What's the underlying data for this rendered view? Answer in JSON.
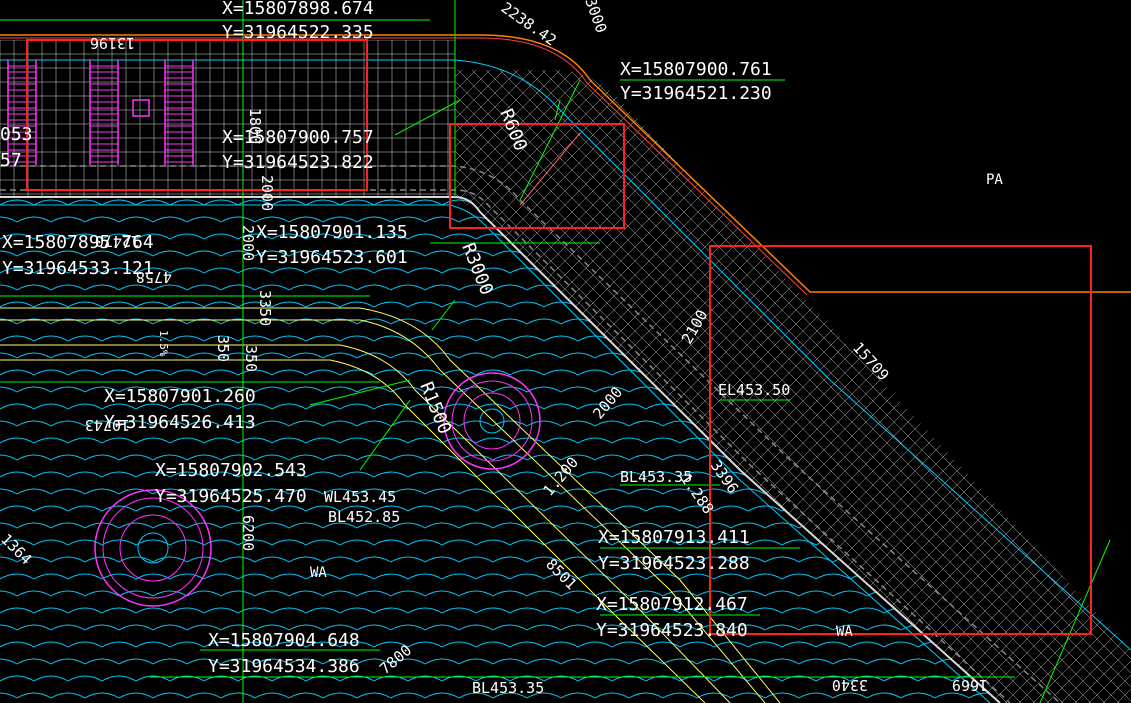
{
  "colors": {
    "background": "#000000",
    "coordinate_text": "#ffffff",
    "leader": "#00ff00",
    "water_line": "#00ccff",
    "boundary": "#ff7f00",
    "highlight_box": "#ff2020",
    "grid": "#d8d8d8",
    "contour_yellow": "#ffff66",
    "magenta": "#ff33ff",
    "cyan": "#00ffff"
  },
  "zone_labels": [
    "PA",
    "WA",
    "WA"
  ],
  "coordinates": [
    {
      "x": "X=15807898.674",
      "y": "Y=31964522.335"
    },
    {
      "x": "X=15807900.761",
      "y": "Y=31964521.230"
    },
    {
      "x": "X=15807900.757",
      "y": "Y=31964523.822"
    },
    {
      "x": "X=15807901.135",
      "y": "Y=31964523.601"
    },
    {
      "x": "X=15807895.764",
      "y": "Y=31964533.121"
    },
    {
      "x": "X=15807901.260",
      "y": "Y=31964526.413"
    },
    {
      "x": "X=15807902.543",
      "y": "Y=31964525.470"
    },
    {
      "x": "X=15807913.411",
      "y": "Y=31964523.288"
    },
    {
      "x": "X=15807912.467",
      "y": "Y=31964523.840"
    },
    {
      "x": "X=15807904.648",
      "y": "Y=31964534.386"
    }
  ],
  "level_labels": [
    "WL453.45",
    "BL452.85",
    "EL453.50",
    "BL453.35",
    "BL453.35"
  ],
  "radius_labels": [
    "R600",
    "R3000",
    "R1500"
  ],
  "dimension_labels": [
    "13196",
    "3000",
    "2238.42",
    "1800",
    "2000",
    "2000",
    "3350",
    "350",
    "350",
    "2000",
    "1.200",
    "2100",
    "6200",
    "8501",
    "7800",
    "3340",
    "1669",
    "15709",
    "1364",
    "12470",
    "4758",
    "10743",
    "3396",
    "1.288"
  ],
  "misc_labels": [
    "053",
    "57",
    "1.5%"
  ]
}
